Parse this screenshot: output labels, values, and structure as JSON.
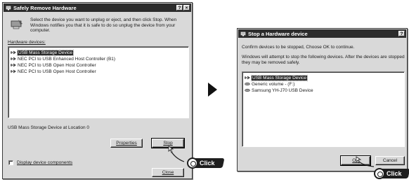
{
  "left_window": {
    "title": "Safely Remove Hardware",
    "title_buttons": [
      "?",
      "×"
    ],
    "instructions": "Select the device you want to unplug or eject, and then click Stop. When Windows notifies you that it is safe to do so unplug the device from your computer.",
    "devices_label": "Hardware devices:",
    "devices": [
      {
        "label": "USB Mass Storage Device",
        "selected": true
      },
      {
        "label": "NEC PCI to USB Enhanced Host Controller (B1)",
        "selected": false
      },
      {
        "label": "NEC PCI to USB Open Host Controller",
        "selected": false
      },
      {
        "label": "NEC PCI to USB Open Host Controller",
        "selected": false
      }
    ],
    "location_text": "USB Mass Storage Device at Location 0",
    "properties_button": "Properties",
    "stop_button": "Stop",
    "display_components_label": "Display device components",
    "close_button": "Close"
  },
  "right_window": {
    "title": "Stop a Hardware device",
    "title_buttons": [
      "?"
    ],
    "confirm_text": "Confirm devices to be stopped, Choose OK to continue.",
    "attempt_text": "Windows will attempt to stop the following devices. After the devices are stopped they may be removed safely.",
    "devices": [
      {
        "label": "USB Mass Storage Device",
        "selected": true
      },
      {
        "label": "Generic volume - (F:)",
        "selected": false
      },
      {
        "label": "Samsung YH-J70 USB Device",
        "selected": false
      }
    ],
    "ok_button": "OK",
    "cancel_button": "Cancel"
  },
  "annotations": {
    "click_label_1": "Click",
    "click_label_2": "Click"
  },
  "colors": {
    "dialog_bg": "#d9d9d9",
    "titlebar": "#2c2c2c",
    "selection": "#2a2a2a"
  }
}
